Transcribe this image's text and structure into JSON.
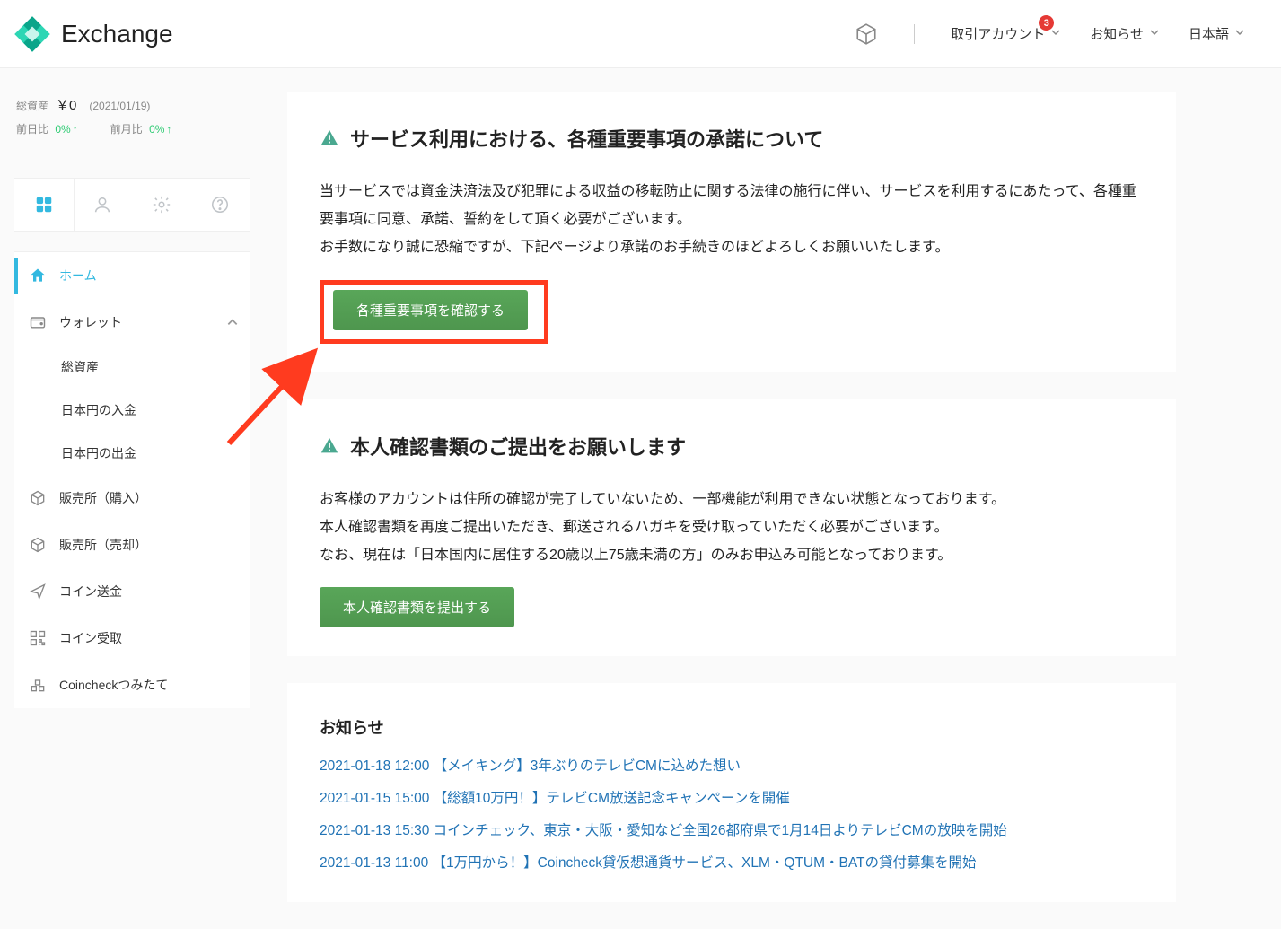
{
  "header": {
    "logo_text": "Exchange",
    "nav_account": "取引アカウント",
    "nav_news": "お知らせ",
    "nav_lang": "日本語",
    "badge_count": "3"
  },
  "sidebar": {
    "total_label": "総資産",
    "total_value": "￥0",
    "date": "(2021/01/19)",
    "day_label": "前日比",
    "day_value": "0%",
    "month_label": "前月比",
    "month_value": "0%",
    "nav": {
      "home": "ホーム",
      "wallet": "ウォレット",
      "wallet_sub1": "総資産",
      "wallet_sub2": "日本円の入金",
      "wallet_sub3": "日本円の出金",
      "buy": "販売所（購入）",
      "sell": "販売所（売却）",
      "send": "コイン送金",
      "receive": "コイン受取",
      "tsumitate": "Coincheckつみたて"
    }
  },
  "panel1": {
    "title": "サービス利用における、各種重要事項の承諾について",
    "body1": "当サービスでは資金決済法及び犯罪による収益の移転防止に関する法律の施行に伴い、サービスを利用するにあたって、各種重要事項に同意、承諾、誓約をして頂く必要がございます。",
    "body2": "お手数になり誠に恐縮ですが、下記ページより承諾のお手続きのほどよろしくお願いいたします。",
    "button": "各種重要事項を確認する"
  },
  "panel2": {
    "title": "本人確認書類のご提出をお願いします",
    "body1": "お客様のアカウントは住所の確認が完了していないため、一部機能が利用できない状態となっております。",
    "body2": "本人確認書類を再度ご提出いただき、郵送されるハガキを受け取っていただく必要がございます。",
    "body3": "なお、現在は「日本国内に居住する20歳以上75歳未満の方」のみお申込み可能となっております。",
    "button": "本人確認書類を提出する"
  },
  "news": {
    "title": "お知らせ",
    "items": [
      "2021-01-18 12:00 【メイキング】3年ぶりのテレビCMに込めた想い",
      "2021-01-15 15:00 【総額10万円！】テレビCM放送記念キャンペーンを開催",
      "2021-01-13 15:30 コインチェック、東京・大阪・愛知など全国26都府県で1月14日よりテレビCMの放映を開始",
      "2021-01-13 11:00 【1万円から！】Coincheck貸仮想通貨サービス、XLM・QTUM・BATの貸付募集を開始"
    ]
  }
}
